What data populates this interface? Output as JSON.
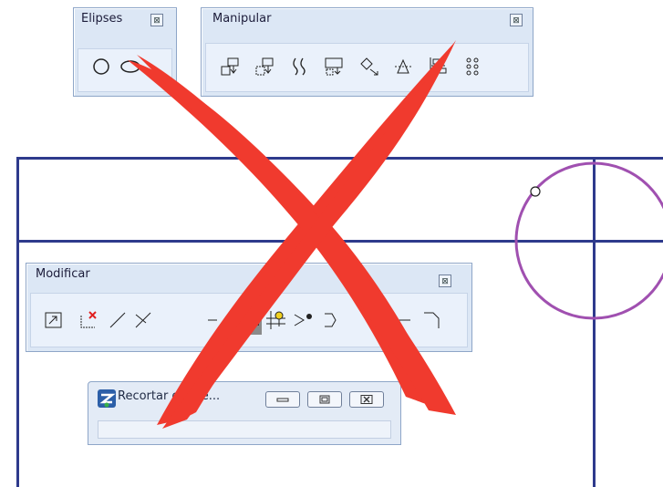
{
  "palettes": {
    "elipses": {
      "title": "Elipses",
      "close_glyph": "⊠",
      "tools": [
        "circle-icon",
        "ellipse-icon"
      ]
    },
    "manipular": {
      "title": "Manipular",
      "close_glyph": "⊠",
      "tools": [
        "copy-element-icon",
        "move-element-icon",
        "parallel-copy-icon",
        "scale-icon",
        "rotate-icon",
        "mirror-icon",
        "align-icon",
        "array-icon"
      ]
    },
    "modificar": {
      "title": "Modificar",
      "close_glyph": "⊠",
      "tools": [
        "modify-element-icon",
        "delete-part-icon",
        "extend-line-icon",
        "extend-two-icon",
        "trim-to-intersection-icon",
        "trim-elements-icon",
        "intelli-trim-icon",
        "fillet-icon",
        "chamfer-icon",
        "break-icon",
        "corner-icon"
      ],
      "active_tool": "trim-elements-icon"
    }
  },
  "dialog": {
    "title": "Recortar eleme...",
    "buttons": [
      "minimize-icon",
      "maximize-icon",
      "close-icon"
    ]
  },
  "colors": {
    "line": "#2e3a8c",
    "circle": "#a050b0",
    "overlay_x": "#f03a2e",
    "palette_bg": "#dce7f5"
  }
}
